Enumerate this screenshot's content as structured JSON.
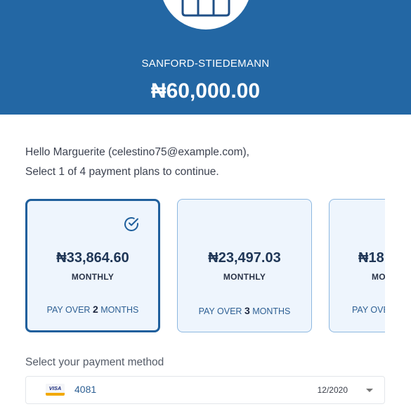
{
  "merchant": {
    "name": "SANFORD-STIEDEMANN",
    "amount": "₦60,000.00"
  },
  "greeting": {
    "line1": "Hello Marguerite (celestino75@example.com),",
    "line2": "Select 1 of 4 payment plans to continue."
  },
  "plans": [
    {
      "price": "₦33,864.60",
      "frequency": "MONTHLY",
      "over_prefix": "PAY OVER",
      "months": "2",
      "over_suffix": "MONTHS",
      "selected": true
    },
    {
      "price": "₦23,497.03",
      "frequency": "MONTHLY",
      "over_prefix": "PAY OVER",
      "months": "3",
      "over_suffix": "MONTHS",
      "selected": false
    },
    {
      "price": "₦18,",
      "frequency": "MO",
      "over_prefix": "PAY OVE",
      "months": "",
      "over_suffix": "",
      "selected": false
    }
  ],
  "payment_method": {
    "label": "Select your payment method",
    "card_brand": "VISA",
    "last4": "4081",
    "expiry": "12/2020"
  },
  "colors": {
    "header_bg": "#2367a4",
    "card_bg": "#eef5fd",
    "selected_border": "#1f5f9c"
  }
}
